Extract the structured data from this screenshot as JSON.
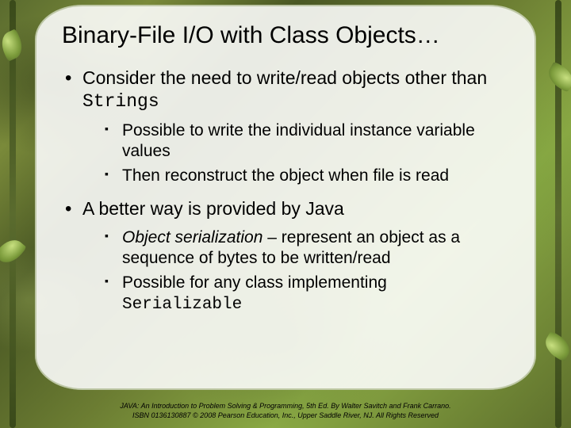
{
  "title": "Binary-File I/O with Class Objects…",
  "bullets": {
    "b1_pre": "Consider the need to write/read objects other than ",
    "b1_code": "Strings",
    "b1_sub1": "Possible to write the individual instance variable values",
    "b1_sub2": "Then reconstruct the object when file is read",
    "b2": "A better way is provided by Java",
    "b2_sub1_em": "Object serialization",
    "b2_sub1_rest": " – represent an object as a sequence of bytes to be written/read",
    "b2_sub2_pre": "Possible for any class implementing ",
    "b2_sub2_code": "Serializable"
  },
  "footer": {
    "line1": "JAVA: An Introduction to Problem Solving & Programming, 5th Ed. By Walter Savitch and Frank Carrano.",
    "line2": "ISBN 0136130887 © 2008 Pearson Education, Inc., Upper Saddle River, NJ. All Rights Reserved"
  }
}
